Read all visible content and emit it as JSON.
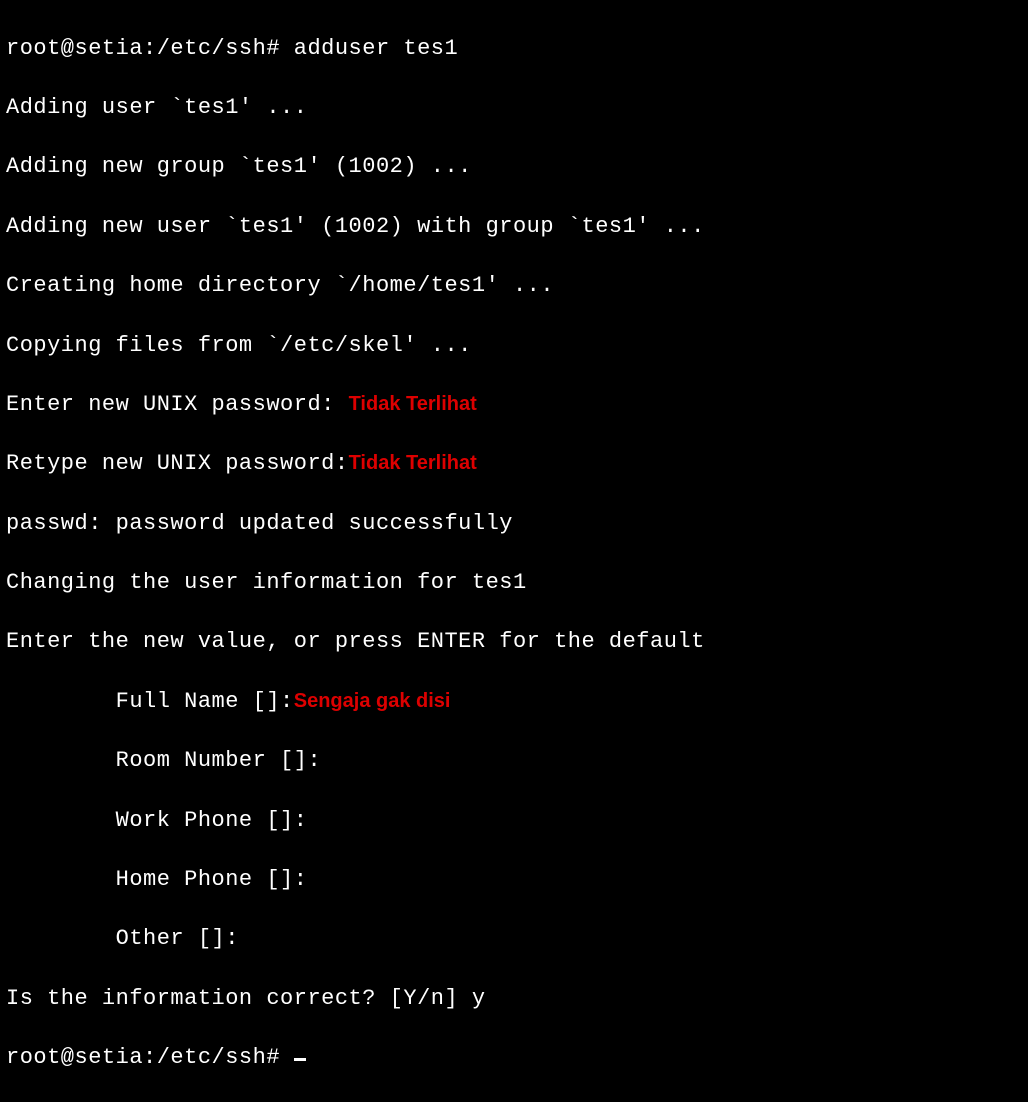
{
  "prompt1": "root@setia:/etc/ssh# ",
  "command1": "adduser tes1",
  "lines": {
    "l1": "Adding user `tes1' ...",
    "l2": "Adding new group `tes1' (1002) ...",
    "l3": "Adding new user `tes1' (1002) with group `tes1' ...",
    "l4": "Creating home directory `/home/tes1' ...",
    "l5": "Copying files from `/etc/skel' ...",
    "l6": "Enter new UNIX password: ",
    "l7": "Retype new UNIX password:",
    "l8": "passwd: password updated successfully",
    "l9": "Changing the user information for tes1",
    "l10": "Enter the new value, or press ENTER for the default",
    "l11": "        Full Name []:",
    "l12": "        Room Number []:",
    "l13": "        Work Phone []:",
    "l14": "        Home Phone []:",
    "l15": "        Other []:",
    "l16": "Is the information correct? [Y/n] ",
    "l16answer": "y"
  },
  "annotations": {
    "a1": "Tidak Terlihat",
    "a2": "Tidak Terlihat",
    "a3": "Sengaja gak disi"
  },
  "prompt2": "root@setia:/etc/ssh# "
}
